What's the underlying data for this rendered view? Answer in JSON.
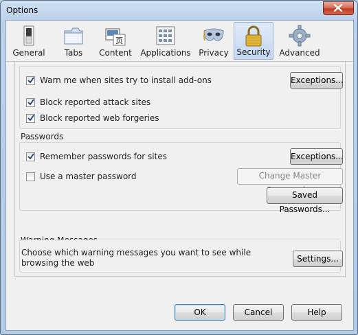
{
  "window": {
    "title": "Options",
    "close_label": "Close"
  },
  "toolbar": {
    "panes": [
      {
        "label": "General",
        "icon": "general-switch-icon"
      },
      {
        "label": "Tabs",
        "icon": "tabs-icon"
      },
      {
        "label": "Content",
        "icon": "content-icon"
      },
      {
        "label": "Applications",
        "icon": "applications-icon"
      },
      {
        "label": "Privacy",
        "icon": "privacy-mask-icon"
      },
      {
        "label": "Security",
        "icon": "padlock-icon",
        "selected": true
      },
      {
        "label": "Advanced",
        "icon": "gear-icon"
      }
    ]
  },
  "security": {
    "warn_addons": {
      "label": "Warn me when sites try to install add-ons",
      "checked": true
    },
    "exceptions_addons_label": "Exceptions...",
    "block_attack": {
      "label": "Block reported attack sites",
      "checked": true
    },
    "block_forgeries": {
      "label": "Block reported web forgeries",
      "checked": true
    }
  },
  "passwords": {
    "heading": "Passwords",
    "remember": {
      "label": "Remember passwords for sites",
      "checked": true
    },
    "exceptions_label": "Exceptions...",
    "master": {
      "label": "Use a master password",
      "checked": false
    },
    "change_master_label": "Change Master Password...",
    "saved_label": "Saved Passwords..."
  },
  "warnings": {
    "heading": "Warning Messages",
    "description": "Choose which warning messages you want to see while browsing the web",
    "settings_label": "Settings..."
  },
  "footer": {
    "ok_label": "OK",
    "cancel_label": "Cancel",
    "help_label": "Help"
  }
}
